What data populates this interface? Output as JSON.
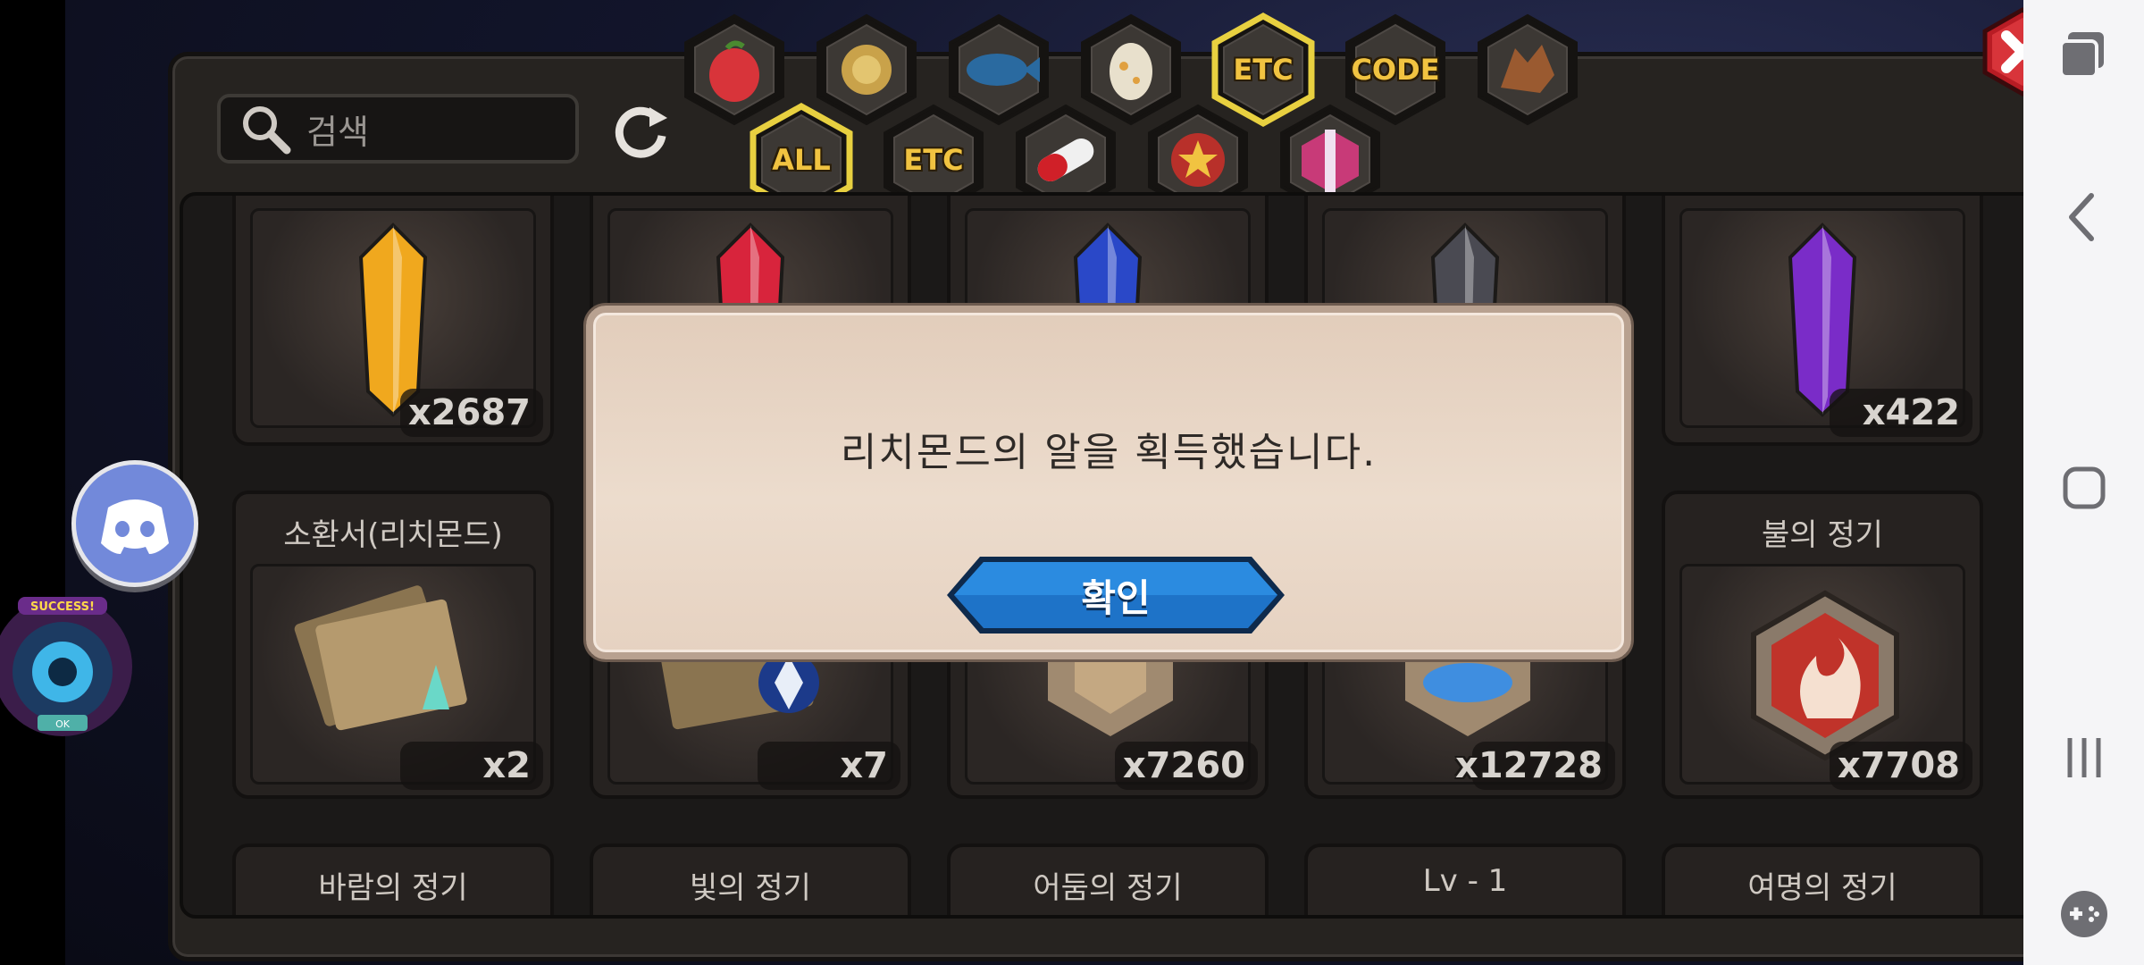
{
  "search": {
    "placeholder": "검색"
  },
  "tabs_row1": [
    {
      "name": "fruit",
      "label": ""
    },
    {
      "name": "seed",
      "label": ""
    },
    {
      "name": "fish",
      "label": ""
    },
    {
      "name": "egg",
      "label": ""
    },
    {
      "name": "etc",
      "label": "ETC",
      "selected": true
    },
    {
      "name": "code",
      "label": "CODE"
    },
    {
      "name": "dragon",
      "label": ""
    }
  ],
  "tabs_row2": [
    {
      "name": "all",
      "label": "ALL",
      "selected": true
    },
    {
      "name": "etc2",
      "label": "ETC"
    },
    {
      "name": "pill",
      "label": ""
    },
    {
      "name": "medal",
      "label": ""
    },
    {
      "name": "box",
      "label": ""
    }
  ],
  "items_row1": [
    {
      "color": "#f0a81e",
      "count": "x2687"
    },
    {
      "color": "#d8243c",
      "count": ""
    },
    {
      "color": "#2a48c8",
      "count": ""
    },
    {
      "color": "#4a4a52",
      "count": ""
    },
    {
      "color": "#7a2cc8",
      "count": "x422"
    }
  ],
  "items_row2": [
    {
      "name": "소환서(리치몬드)",
      "count": "x2"
    },
    {
      "name": "",
      "count": "x7"
    },
    {
      "name": "",
      "count": "x7260"
    },
    {
      "name": "",
      "count": "x12728"
    },
    {
      "name": "불의 정기",
      "count": "x7708"
    }
  ],
  "items_row3": [
    "바람의 정기",
    "빛의 정기",
    "어둠의 정기",
    "Lv - 1",
    "여명의 정기"
  ],
  "dialog": {
    "message": "리치몬드의 알을 획득했습니다.",
    "confirm_label": "확인"
  },
  "success_badge": {
    "top": "SUCCESS!",
    "bottom": "OK"
  },
  "colors": {
    "accent_gold": "#f1c341",
    "button_blue": "#1e73c8",
    "close_red": "#c8202a"
  }
}
